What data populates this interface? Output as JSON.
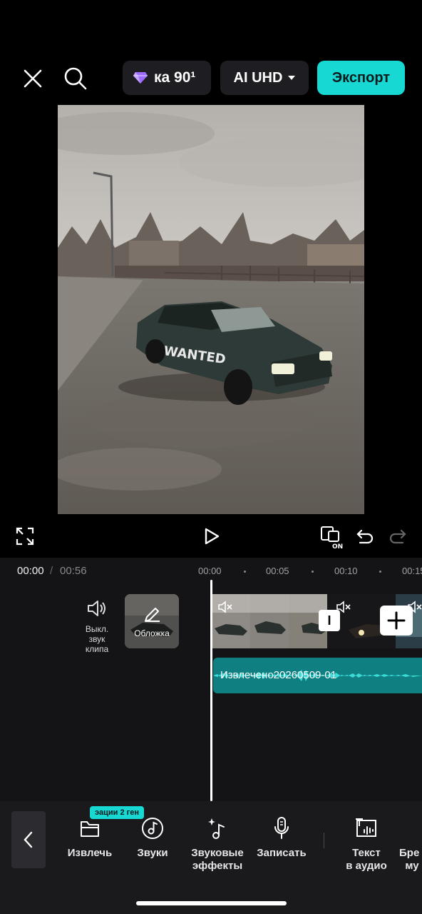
{
  "header": {
    "pro_label": "ка 90¹",
    "quality_label": "AI UHD",
    "export_label": "Экспорт"
  },
  "timecode": {
    "current": "00:00",
    "separator": "/",
    "total": "00:56"
  },
  "ruler": [
    "00:00",
    "00:05",
    "00:10",
    "00:15"
  ],
  "timeline": {
    "mute_clip_label": "Выкл. звук клипа",
    "cover_label": "Обложка",
    "split_label": "I",
    "audio_clip_name": "Извлечено20260509-01"
  },
  "toolbar": {
    "badge": "эации  2 ген",
    "items": [
      {
        "label": "Извлечь",
        "icon": "extract-icon"
      },
      {
        "label": "Звуки",
        "icon": "music-disc-icon"
      },
      {
        "label": "Звуковые эффекты",
        "icon": "sound-effects-icon"
      },
      {
        "label": "Записать",
        "icon": "microphone-icon"
      },
      {
        "label": "Текст в аудио",
        "icon": "text-to-audio-icon"
      },
      {
        "label": "Бре му",
        "icon": "brand-music-icon"
      }
    ]
  },
  "colors": {
    "accent": "#18d8d4",
    "audio_track": "#0f7f82",
    "background": "#000000",
    "panel": "#1a1a1d"
  }
}
